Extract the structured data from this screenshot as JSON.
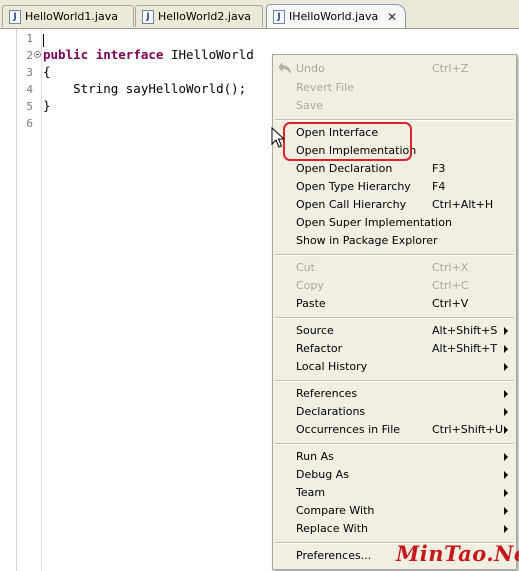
{
  "tabs": [
    {
      "label": "HelloWorld1.java",
      "active": false
    },
    {
      "label": "HelloWorld2.java",
      "active": false
    },
    {
      "label": "IHelloWorld.java",
      "active": true
    }
  ],
  "tab_icon_letter": "J",
  "editor": {
    "line_numbers": [
      "1",
      "2",
      "3",
      "4",
      "5",
      "6"
    ],
    "code": {
      "line2_kw1": "public",
      "line2_kw2": "interface",
      "line2_rest": " IHelloWorld",
      "line3": "{",
      "line4": "    String sayHelloWorld();",
      "line5": "}"
    }
  },
  "context_menu": {
    "items": [
      {
        "label": "Undo",
        "shortcut": "Ctrl+Z",
        "enabled": false,
        "icon": "undo-icon"
      },
      {
        "label": "Revert File",
        "shortcut": "",
        "enabled": false
      },
      {
        "label": "Save",
        "shortcut": "",
        "enabled": false
      },
      {
        "label": "Open Interface",
        "shortcut": "",
        "enabled": true
      },
      {
        "label": "Open Implementation",
        "shortcut": "",
        "enabled": true
      },
      {
        "label": "Open Declaration",
        "shortcut": "F3",
        "enabled": true
      },
      {
        "label": "Open Type Hierarchy",
        "shortcut": "F4",
        "enabled": true
      },
      {
        "label": "Open Call Hierarchy",
        "shortcut": "Ctrl+Alt+H",
        "enabled": true
      },
      {
        "label": "Open Super Implementation",
        "shortcut": "",
        "enabled": true
      },
      {
        "label": "Show in Package Explorer",
        "shortcut": "",
        "enabled": true
      },
      {
        "label": "Cut",
        "shortcut": "Ctrl+X",
        "enabled": false
      },
      {
        "label": "Copy",
        "shortcut": "Ctrl+C",
        "enabled": false
      },
      {
        "label": "Paste",
        "shortcut": "Ctrl+V",
        "enabled": true
      },
      {
        "label": "Source",
        "shortcut": "Alt+Shift+S",
        "enabled": true,
        "submenu": true
      },
      {
        "label": "Refactor",
        "shortcut": "Alt+Shift+T",
        "enabled": true,
        "submenu": true
      },
      {
        "label": "Local History",
        "shortcut": "",
        "enabled": true,
        "submenu": true
      },
      {
        "label": "References",
        "shortcut": "",
        "enabled": true,
        "submenu": true
      },
      {
        "label": "Declarations",
        "shortcut": "",
        "enabled": true,
        "submenu": true
      },
      {
        "label": "Occurrences in File",
        "shortcut": "Ctrl+Shift+U",
        "enabled": true,
        "submenu": true
      },
      {
        "label": "Run As",
        "shortcut": "",
        "enabled": true,
        "submenu": true
      },
      {
        "label": "Debug As",
        "shortcut": "",
        "enabled": true,
        "submenu": true
      },
      {
        "label": "Team",
        "shortcut": "",
        "enabled": true,
        "submenu": true
      },
      {
        "label": "Compare With",
        "shortcut": "",
        "enabled": true,
        "submenu": true
      },
      {
        "label": "Replace With",
        "shortcut": "",
        "enabled": true,
        "submenu": true
      },
      {
        "label": "Preferences...",
        "shortcut": "",
        "enabled": true
      }
    ]
  },
  "colors": {
    "keyword": "#7f0055",
    "highlight_box": "#e0202a",
    "watermark": "#c7161c"
  },
  "watermark": "MinTao.Net"
}
